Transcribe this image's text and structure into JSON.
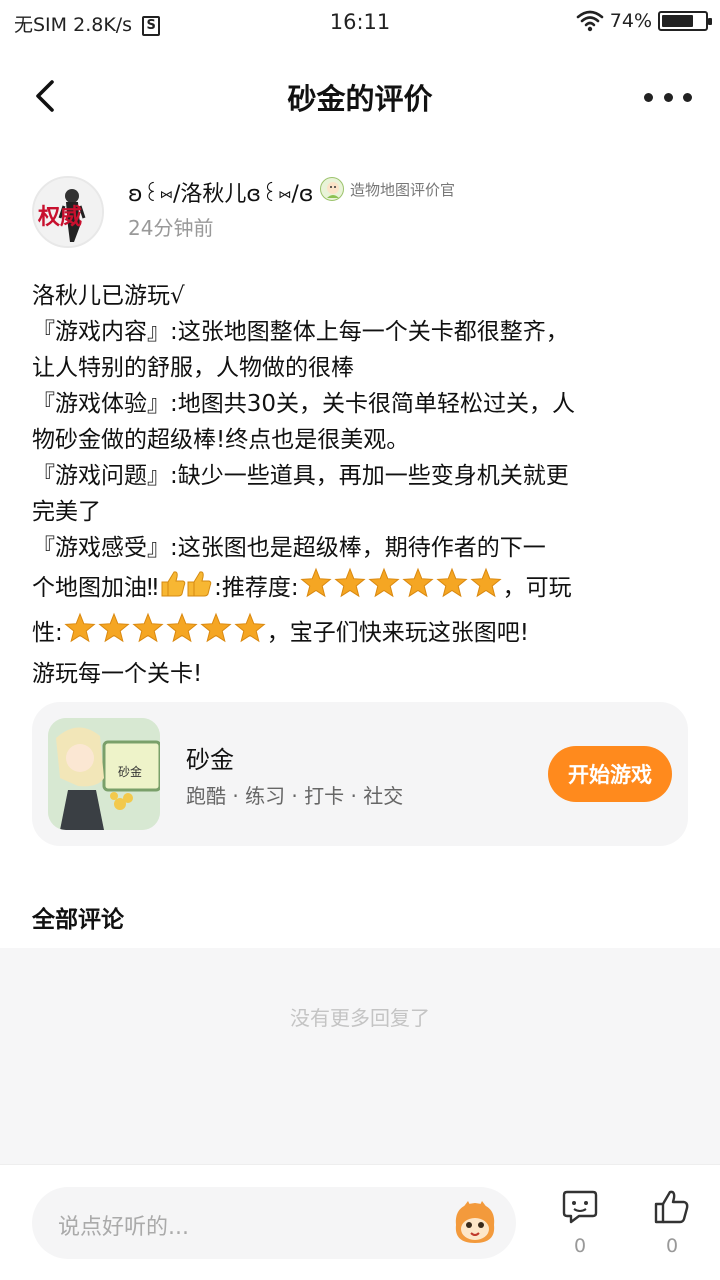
{
  "status_bar": {
    "carrier": "无SIM",
    "speed": "2.8K/s",
    "sim_badge": "S",
    "time": "16:11",
    "battery": "74%",
    "battery_level": 0.74
  },
  "nav": {
    "title": "砂金的评价",
    "back_icon": "chevron-left-icon",
    "more_icon": "more-dots-icon"
  },
  "author": {
    "avatar_text": "权威",
    "name": "ʚ꒰⑅/洛秋儿ɞ꒰⑅/ɞ",
    "badge": "造物地图评价官",
    "time_ago": "24分钟前"
  },
  "review": {
    "line1": "洛秋儿已游玩√",
    "line2": "『游戏内容』:这张地图整体上每一个关卡都很整齐，",
    "line3": "让人特别的舒服，人物做的很棒",
    "line4": "『游戏体验』:地图共30关，关卡很简单轻松过关，人",
    "line5": "物砂金做的超级棒!终点也是很美观。",
    "line6": "『游戏问题』:缺少一些道具，再加一些变身机关就更",
    "line7": "完美了",
    "line8": "『游戏感受』:这张图也是超级棒，期待作者的下一",
    "line9_a": "个地图加油‼",
    "line9_b": ":推荐度:",
    "line9_c": "，可玩",
    "line10_a": "性:",
    "line10_b": "，宝子们快来玩这张图吧!",
    "line11": "游玩每一个关卡!",
    "recommend_stars": 6,
    "playability_stars": 6
  },
  "game": {
    "name": "砂金",
    "tags": "跑酷 · 练习 · 打卡 · 社交",
    "thumb_text": "砂金",
    "start_label": "开始游戏"
  },
  "comments": {
    "title": "全部评论",
    "empty_text": "没有更多回复了"
  },
  "bottom": {
    "placeholder": "说点好听的...",
    "comment_count": "0",
    "like_count": "0"
  },
  "colors": {
    "accent": "#ff8a1d",
    "star": "#f5a623"
  }
}
